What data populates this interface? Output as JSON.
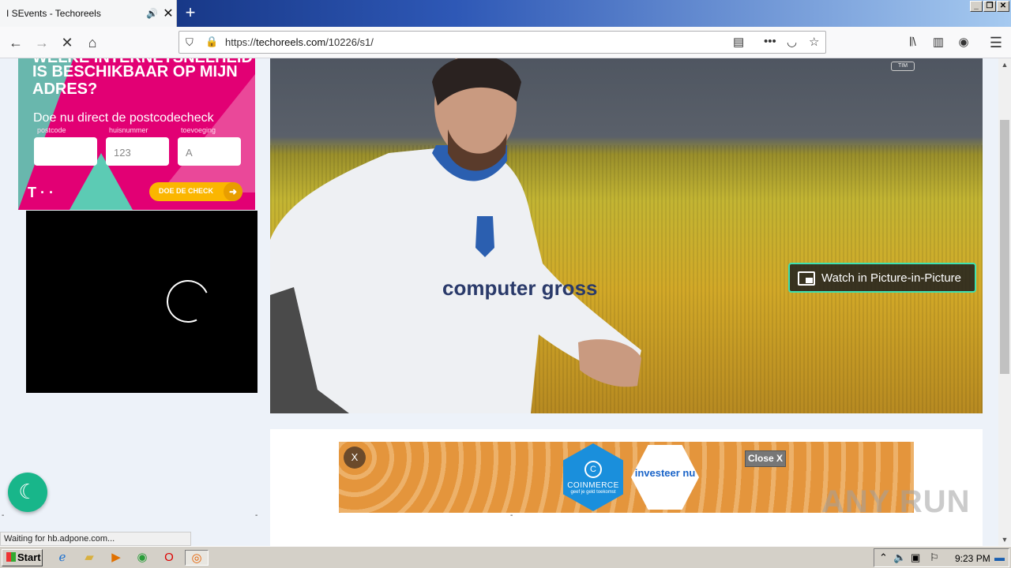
{
  "browser": {
    "tab_title": "I SEvents - Techoreels",
    "tab_sound_icon": "speaker-icon",
    "tab_close": "✕",
    "new_tab": "+",
    "url_prefix": "https://",
    "url_domain": "techoreels.com",
    "url_path": "/10226/s1/",
    "status_text": "Waiting for hb.adpone.com..."
  },
  "ad_telekom": {
    "headline": "IS BESCHIKBAAR OP MIJN ADRES?",
    "headline_partial": "WELKE INTERNETSNELHEID",
    "subline": "Doe nu direct de postcodecheck",
    "labels": [
      "postcode",
      "huisnummer",
      "toevoeging"
    ],
    "placeholders": [
      "",
      "123",
      "A"
    ],
    "logo": "T · ·",
    "cta": "DOE DE CHECK",
    "cta_arrow": "➜"
  },
  "video": {
    "pip_label": "Watch in Picture-in-Picture",
    "broadcaster_badge": "TIM",
    "jersey_text": "computer gross",
    "accent_color": "#3fe1b0"
  },
  "banner_ad": {
    "close_small": "X",
    "brand": "COINMERCE",
    "brand_logo": "C",
    "brand_slogan": "geef je geld toekomst",
    "cta": "investeer nu",
    "close_label": "Close X"
  },
  "page": {
    "dash_left": "-",
    "dash_mid": "-",
    "dash_center": "-",
    "watermark": "ANY RUN",
    "dark_mode_icon": "moon-icon"
  },
  "taskbar": {
    "start_label": "Start",
    "clock": "9:23 PM",
    "apps": [
      "ie-icon",
      "explorer-icon",
      "media-player-icon",
      "chrome-icon",
      "opera-icon",
      "firefox-icon"
    ]
  }
}
